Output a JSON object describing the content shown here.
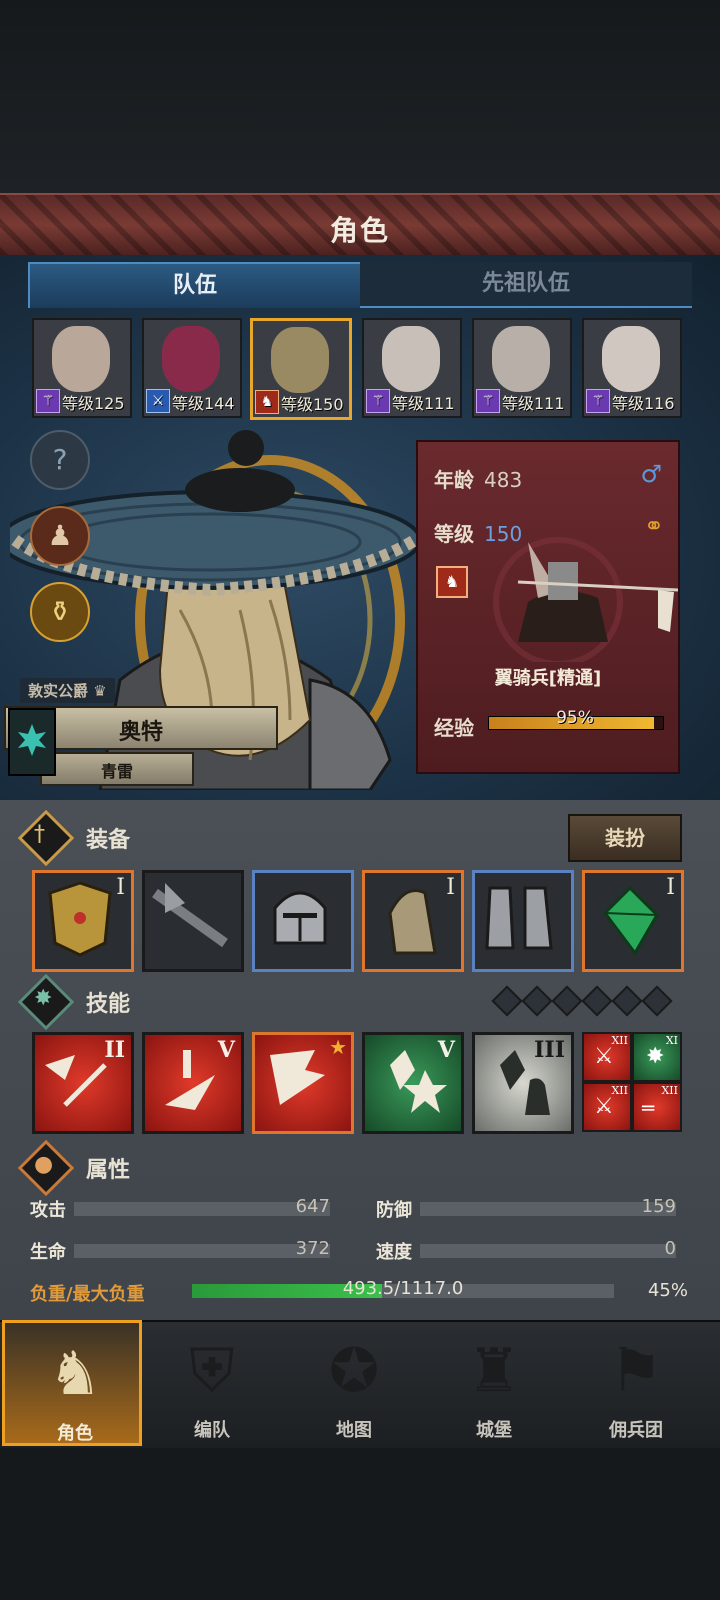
{
  "header": {
    "title": "角色"
  },
  "tabs": [
    {
      "label": "队伍",
      "active": true
    },
    {
      "label": "先祖队伍",
      "active": false
    }
  ],
  "roster": [
    {
      "level_text": "等级125",
      "class_icon": "staff-icon",
      "selected": false
    },
    {
      "level_text": "等级144",
      "class_icon": "sword-icon",
      "selected": false
    },
    {
      "level_text": "等级150",
      "class_icon": "cavalry-icon",
      "selected": true
    },
    {
      "level_text": "等级111",
      "class_icon": "staff-icon",
      "selected": false
    },
    {
      "level_text": "等级111",
      "class_icon": "staff-icon",
      "selected": false
    },
    {
      "level_text": "等级116",
      "class_icon": "staff-icon",
      "selected": false
    }
  ],
  "hero": {
    "title_tag": "敦实公爵",
    "name": "奥特",
    "subtitle": "青雷"
  },
  "info": {
    "age_label": "年龄",
    "age_value": "483",
    "level_label": "等级",
    "level_value": "150",
    "unit_name": "翼骑兵[精通]",
    "xp_label": "经验",
    "xp_value": "95%",
    "xp_fraction": 0.95
  },
  "equipment": {
    "title": "装备",
    "dress_button": "装扮",
    "slots": [
      {
        "name": "breastplate",
        "rank": "I",
        "rarity": "orange"
      },
      {
        "name": "lance",
        "rank": "",
        "rarity": "none"
      },
      {
        "name": "helmet",
        "rank": "",
        "rarity": "blue"
      },
      {
        "name": "horse-armor",
        "rank": "I",
        "rarity": "orange"
      },
      {
        "name": "boots",
        "rank": "",
        "rarity": "blue"
      },
      {
        "name": "emerald-trinket",
        "rank": "I",
        "rarity": "orange"
      }
    ]
  },
  "skills": {
    "title": "技能",
    "items": [
      {
        "rank": "II",
        "color": "red"
      },
      {
        "rank": "V",
        "color": "red"
      },
      {
        "rank": "",
        "color": "red"
      },
      {
        "rank": "V",
        "color": "green"
      },
      {
        "rank": "III",
        "color": "green"
      }
    ],
    "mini": [
      {
        "rank": "XII",
        "color": "red"
      },
      {
        "rank": "XI",
        "color": "green"
      },
      {
        "rank": "XII",
        "color": "red"
      },
      {
        "rank": "XII",
        "color": "red"
      }
    ]
  },
  "attributes": {
    "title": "属性",
    "attack_label": "攻击",
    "attack_value": "647",
    "defense_label": "防御",
    "defense_value": "159",
    "hp_label": "生命",
    "hp_value": "372",
    "speed_label": "速度",
    "speed_value": "0",
    "load_label": "负重/最大负重",
    "load_value": "493.5/1117.0",
    "load_percent": "45%",
    "load_fraction": 0.45
  },
  "nav": [
    {
      "label": "角色",
      "icon": "knight-icon",
      "active": true
    },
    {
      "label": "编队",
      "icon": "formation-icon",
      "active": false
    },
    {
      "label": "地图",
      "icon": "compass-icon",
      "active": false
    },
    {
      "label": "城堡",
      "icon": "castle-icon",
      "active": false
    },
    {
      "label": "佣兵团",
      "icon": "mercenary-icon",
      "active": false
    }
  ],
  "colors": {
    "accent": "#e8a62a",
    "rarity_orange": "#e0762c",
    "rarity_blue": "#5a82c2",
    "load_bar": "#3ac04a"
  }
}
